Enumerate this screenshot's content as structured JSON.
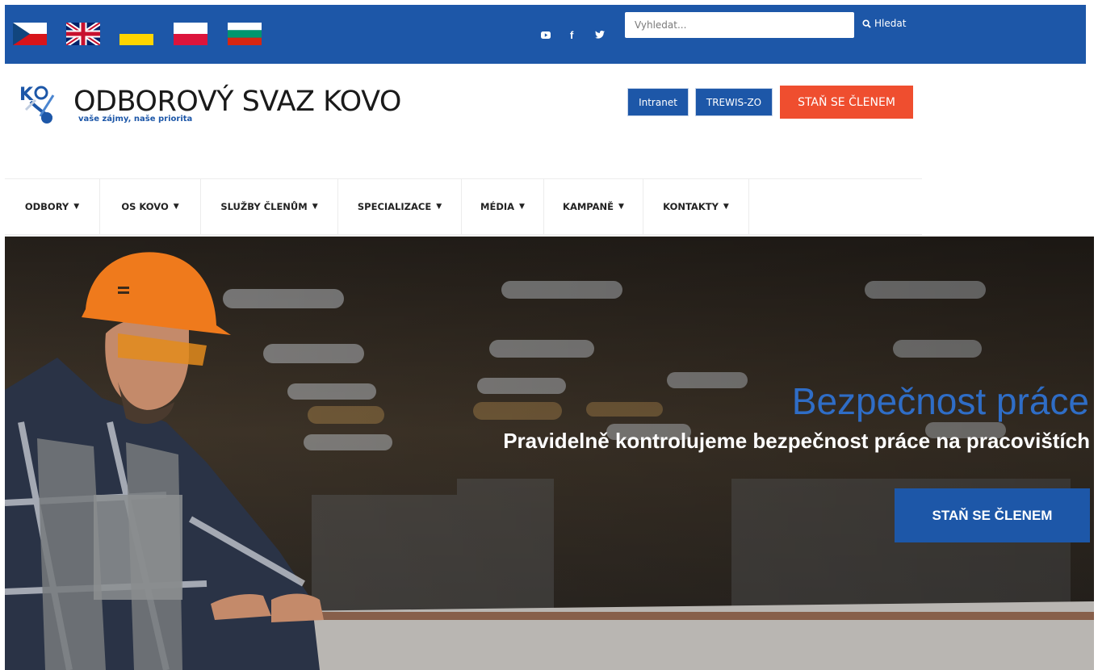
{
  "topbar": {
    "languages": [
      {
        "name": "czech-flag-icon"
      },
      {
        "name": "uk-flag-icon"
      },
      {
        "name": "ukraine-flag-icon"
      },
      {
        "name": "poland-flag-icon"
      },
      {
        "name": "bulgaria-flag-icon"
      }
    ],
    "social": [
      "youtube-icon",
      "facebook-icon",
      "twitter-icon"
    ],
    "search": {
      "placeholder": "Vyhledat...",
      "button_label": "Hledat"
    },
    "background_color": "#1d57a8"
  },
  "header": {
    "logo_title": "ODBOROVÝ SVAZ KOVO",
    "logo_tagline": "vaše zájmy, naše priorita",
    "buttons": {
      "intranet": "Intranet",
      "trewis": "TREWIS-ZO",
      "member": "STAŇ SE ČLENEM"
    },
    "accent_color": "#ef4e2f"
  },
  "nav": {
    "items": [
      {
        "label": "ODBORY"
      },
      {
        "label": "OS KOVO"
      },
      {
        "label": "SLUŽBY ČLENŮM"
      },
      {
        "label": "SPECIALIZACE"
      },
      {
        "label": "MÉDIA"
      },
      {
        "label": "KAMPANĚ"
      },
      {
        "label": "KONTAKTY"
      }
    ]
  },
  "hero": {
    "title": "Bezpečnost práce",
    "subtitle": "Pravidelně kontrolujeme bezpečnost práce na pracovištích",
    "button_label": "STAŇ SE ČLENEM"
  }
}
